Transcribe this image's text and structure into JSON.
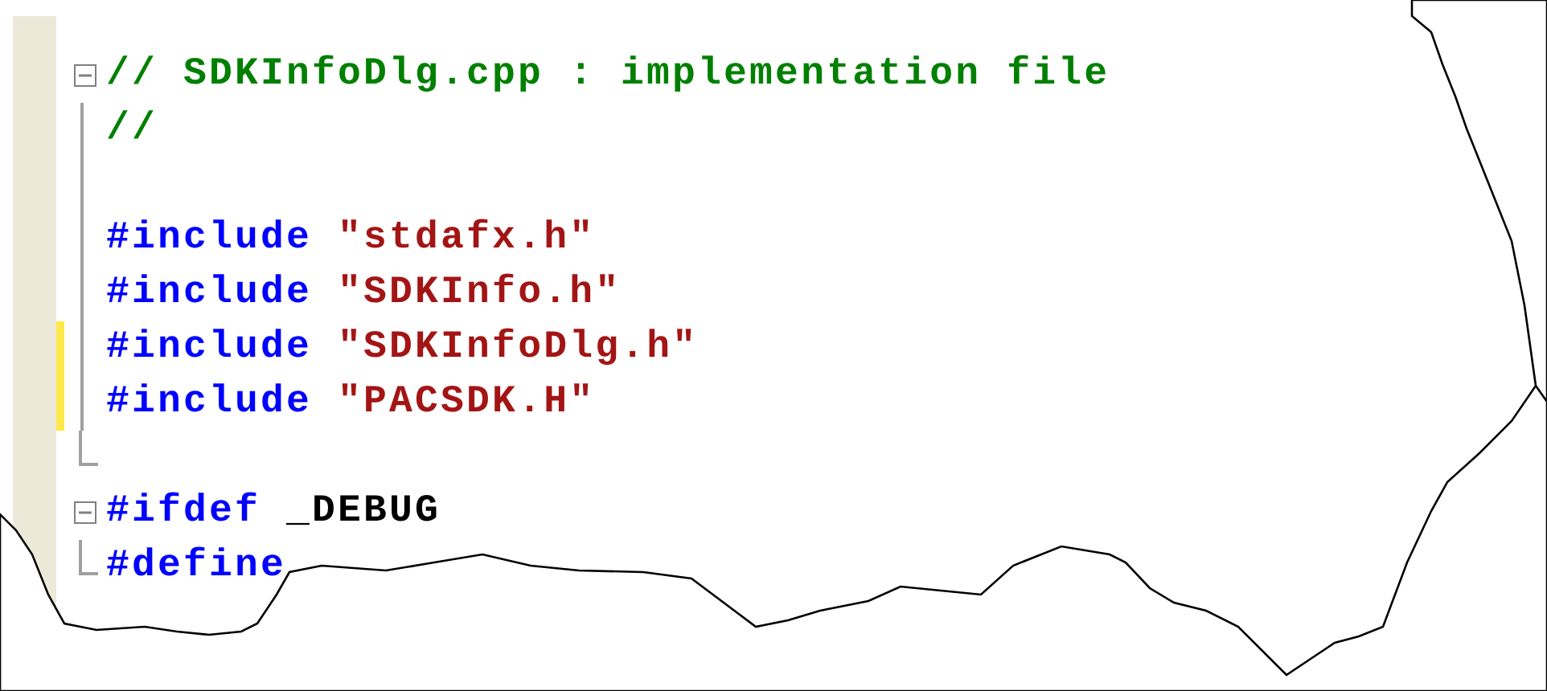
{
  "editor": {
    "lines": [
      {
        "kind": "fold_start",
        "changed": false,
        "tokens": [
          {
            "kind": "comment",
            "text": "// SDKInfoDlg.cpp : implementation file"
          }
        ]
      },
      {
        "kind": "fold_middle",
        "changed": false,
        "tokens": [
          {
            "kind": "comment",
            "text": "//"
          }
        ]
      },
      {
        "kind": "fold_middle",
        "changed": false
      },
      {
        "kind": "fold_middle",
        "changed": false,
        "tokens": [
          {
            "kind": "keyword",
            "text": "#include"
          },
          {
            "kind": "string",
            "text": "\"stdafx.h\""
          }
        ]
      },
      {
        "kind": "fold_middle",
        "changed": false,
        "tokens": [
          {
            "kind": "keyword",
            "text": "#include"
          },
          {
            "kind": "string",
            "text": "\"SDKInfo.h\""
          }
        ]
      },
      {
        "kind": "fold_middle",
        "changed": true,
        "tokens": [
          {
            "kind": "keyword",
            "text": "#include"
          },
          {
            "kind": "string",
            "text": "\"SDKInfoDlg.h\""
          }
        ]
      },
      {
        "kind": "fold_middle",
        "changed": true,
        "tokens": [
          {
            "kind": "keyword",
            "text": "#include"
          },
          {
            "kind": "string",
            "text": "\"PACSDK.H\""
          }
        ]
      },
      {
        "kind": "fold_end",
        "changed": false
      },
      {
        "kind": "fold_start",
        "changed": false,
        "tokens": [
          {
            "kind": "keyword",
            "text": "#ifdef"
          },
          {
            "kind": "plain",
            "text": "_DEBUG"
          }
        ]
      },
      {
        "kind": "fold_end",
        "changed": false,
        "tokens": [
          {
            "kind": "keyword",
            "text": "#define"
          }
        ]
      }
    ]
  }
}
